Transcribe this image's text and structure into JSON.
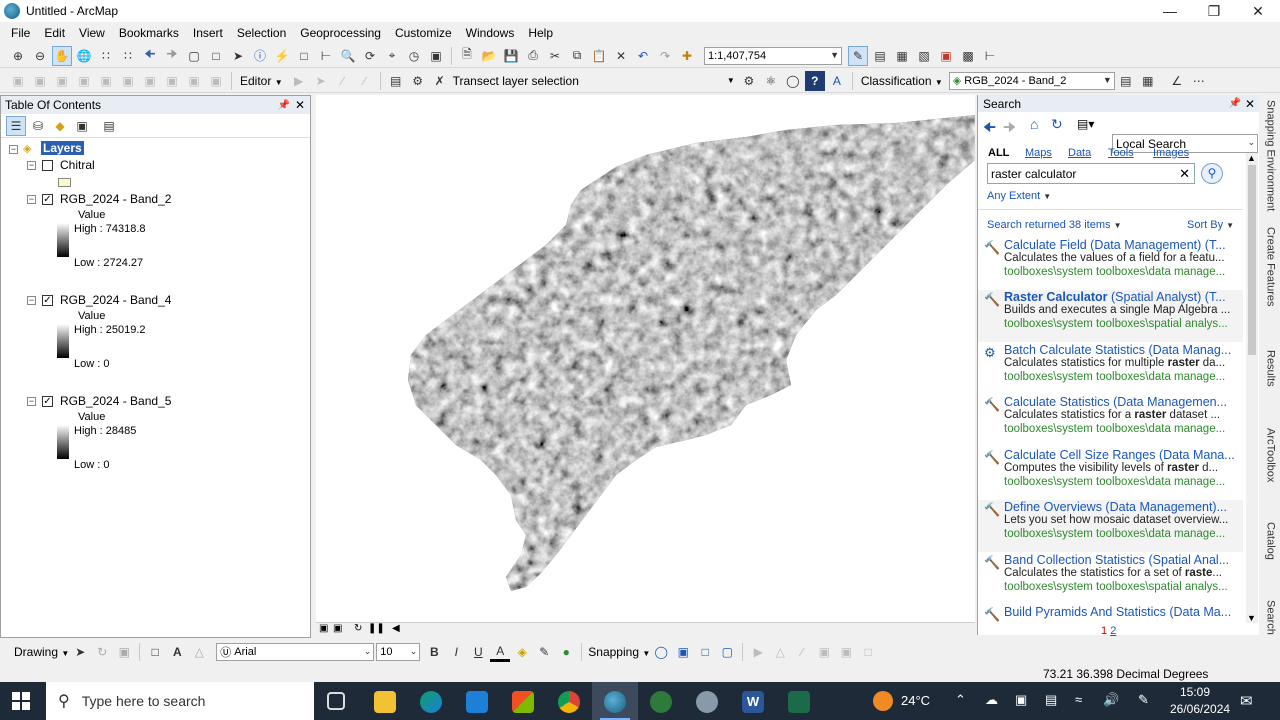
{
  "window": {
    "title": "Untitled - ArcMap"
  },
  "menu": [
    "File",
    "Edit",
    "View",
    "Bookmarks",
    "Insert",
    "Selection",
    "Geoprocessing",
    "Customize",
    "Windows",
    "Help"
  ],
  "toolbar": {
    "scale": "1:1,407,754",
    "editor_label": "Editor",
    "transect_label": "Transect layer selection",
    "classification_label": "Classification",
    "layer_combo": "RGB_2024 - Band_2"
  },
  "toc": {
    "title": "Table Of Contents",
    "root": "Layers",
    "layers": [
      {
        "name": "Chitral"
      },
      {
        "name": "RGB_2024 - Band_2",
        "value_label": "Value",
        "high": "High : 74318.8",
        "low": "Low : 2724.27"
      },
      {
        "name": "RGB_2024 - Band_4",
        "value_label": "Value",
        "high": "High : 25019.2",
        "low": "Low : 0"
      },
      {
        "name": "RGB_2024 - Band_5",
        "value_label": "Value",
        "high": "High : 28485",
        "low": "Low : 0"
      }
    ]
  },
  "search": {
    "title": "Search",
    "scope": "Local Search",
    "filters": [
      "ALL",
      "Maps",
      "Data",
      "Tools",
      "Images"
    ],
    "query": "raster calculator",
    "extent": "Any Extent",
    "count": "Search returned 38 items",
    "sort": "Sort By",
    "pages": [
      "1",
      "2"
    ],
    "results": [
      {
        "title": "Calculate Field (Data Management) (T...",
        "desc": "Calculates the values of a field for a featu...",
        "path": "toolboxes\\system toolboxes\\data manage..."
      },
      {
        "title_bold": "Raster Calculator",
        "title": " (Spatial Analyst) (T...",
        "desc": "Builds and executes a single Map Algebra ...",
        "path": "toolboxes\\system toolboxes\\spatial analys..."
      },
      {
        "title": "Batch Calculate Statistics (Data Manag...",
        "desc_pre": "Calculates statistics for multiple ",
        "desc_bold": "raster",
        "desc": " da...",
        "path": "toolboxes\\system toolboxes\\data manage..."
      },
      {
        "title": "Calculate Statistics (Data Managemen...",
        "desc_pre": "Calculates statistics for a ",
        "desc_bold": "raster",
        "desc": " dataset ...",
        "path": "toolboxes\\system toolboxes\\data manage..."
      },
      {
        "title": "Calculate Cell Size Ranges (Data Mana...",
        "desc_pre": "Computes the visibility levels of ",
        "desc_bold": "raster",
        "desc": " d...",
        "path": "toolboxes\\system toolboxes\\data manage..."
      },
      {
        "title": "Define Overviews (Data Management)...",
        "desc": "Lets you set how mosaic dataset overview...",
        "path": "toolboxes\\system toolboxes\\data manage..."
      },
      {
        "title": "Band Collection Statistics (Spatial Anal...",
        "desc_pre": "Calculates the statistics for a set of ",
        "desc_bold": "raste",
        "desc": "...",
        "path": "toolboxes\\system toolboxes\\spatial analys..."
      },
      {
        "title": "Build Pyramids And Statistics (Data Ma...",
        "desc": "",
        "path": ""
      }
    ]
  },
  "dock_tabs": [
    "Snapping Environment",
    "Create Features",
    "Results",
    "ArcToolbox",
    "Catalog",
    "Search"
  ],
  "drawing": {
    "label": "Drawing",
    "font": "Arial",
    "size": "10",
    "snapping": "Snapping"
  },
  "status": {
    "coords": "73.21  36.398 Decimal Degrees"
  },
  "taskbar": {
    "search_placeholder": "Type here to search",
    "temp": "24°C",
    "time": "15:09",
    "date": "26/06/2024"
  }
}
